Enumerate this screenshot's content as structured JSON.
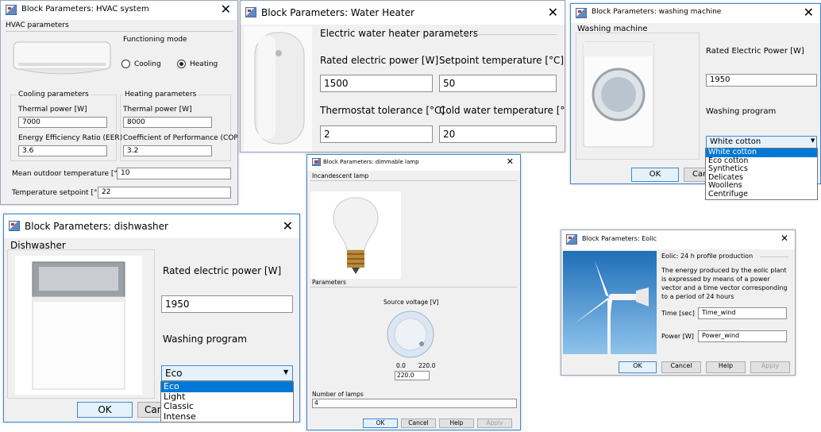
{
  "hvac": {
    "title": "Block Parameters: HVAC system",
    "group_label": "HVAC parameters",
    "mode_label": "Functioning mode",
    "mode_cooling": "Cooling",
    "mode_heating": "Heating",
    "cooling_label": "Cooling parameters",
    "heating_label": "Heating parameters",
    "thermal_power_label": "Thermal power [W]",
    "cooling_power": "7000",
    "heating_power": "8000",
    "eer_label": "Energy Efficiency Ratio (EER)",
    "eer": "3.6",
    "cop_label": "Coefficient of Performance (COP)",
    "cop": "3.2",
    "outdoor_label": "Mean outdoor temperature [°C]",
    "outdoor": "10",
    "setpoint_label": "Temperature setpoint [°C]",
    "setpoint": "22"
  },
  "heater": {
    "title": "Block Parameters: Water Heater",
    "group_label": "Electric water heater parameters",
    "power_label": "Rated electric power [W]",
    "power": "1500",
    "setpoint_label": "Setpoint temperature [°C]",
    "setpoint": "50",
    "tolerance_label": "Thermostat tolerance  [°C]",
    "tolerance": "2",
    "cold_label": "Cold water temperature [°C]",
    "cold": "20"
  },
  "washer": {
    "title": "Block Parameters: washing machine",
    "group_label": "Washing machine",
    "power_label": "Rated Electric Power [W]",
    "power": "1950",
    "program_label": "Washing program",
    "program": "White cotton",
    "options": [
      "White cotton",
      "Eco cotton",
      "Synthetics",
      "Delicates",
      "Woollens",
      "Centrifuge"
    ],
    "ok": "OK",
    "cancel": "Can"
  },
  "dish": {
    "title": "Block Parameters: dishwasher",
    "group_label": "Dishwasher",
    "power_label": "Rated electric power [W]",
    "power": "1950",
    "program_label": "Washing program",
    "program": "Eco",
    "options": [
      "Eco",
      "Light",
      "Classic",
      "Intense"
    ],
    "ok": "OK",
    "cancel": "Can"
  },
  "lamp": {
    "title": "Block Parameters: dimmable lamp",
    "group_label": "Incandescent lamp",
    "params_label": "Parameters",
    "voltage_label": "Source voltage [V]",
    "min": "0.0",
    "max": "220.0",
    "voltage": "220.0",
    "lamps_label": "Number of lamps",
    "lamps": "4",
    "ok": "OK",
    "cancel": "Cancel",
    "help": "Help",
    "apply": "Apply"
  },
  "eolic": {
    "title": "Block Parameters: Eolic",
    "heading": "Eolic: 24 h profile production",
    "desc1": "The energy produced by the eolic plant",
    "desc2": "is expressed by means of a power",
    "desc3": "vector and a time vector corresponding",
    "desc4": "to a period of 24 hours",
    "time_label": "Time [sec]",
    "time": "Time_wind",
    "power_label": "Power [W]",
    "power": "Power_wind",
    "ok": "OK",
    "cancel": "Cancel",
    "help": "Help",
    "apply": "Apply"
  }
}
